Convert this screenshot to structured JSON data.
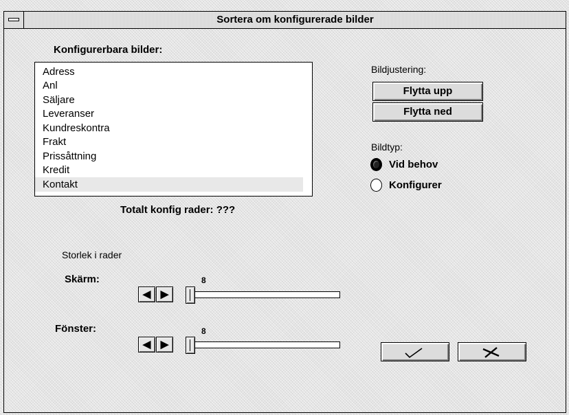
{
  "window": {
    "title": "Sortera om konfigurerade bilder"
  },
  "list": {
    "heading": "Konfigurerbara bilder:",
    "items": [
      "Adress",
      "Anl",
      "Säljare",
      "Leveranser",
      "Kundreskontra",
      "Frakt",
      "Prissåttning",
      "Kredit",
      "Kontakt"
    ],
    "selected": "Kontakt",
    "total_label": "Totalt konfig rader: ???"
  },
  "adjust": {
    "heading": "Bildjustering:",
    "up_label": "Flytta upp",
    "down_label": "Flytta ned"
  },
  "type": {
    "heading": "Bildtyp:",
    "options": [
      {
        "label": "Vid behov",
        "selected": true
      },
      {
        "label": "Konfigurer",
        "selected": false
      }
    ]
  },
  "size": {
    "heading": "Storlek i rader",
    "screen": {
      "label": "Skärm:",
      "value": "8"
    },
    "window": {
      "label": "Fönster:",
      "value": "8"
    }
  },
  "icons": {
    "menu": "system-menu-icon",
    "left": "arrow-left-icon",
    "right": "arrow-right-icon",
    "ok": "checkmark-icon",
    "cancel": "x-cross-icon"
  }
}
